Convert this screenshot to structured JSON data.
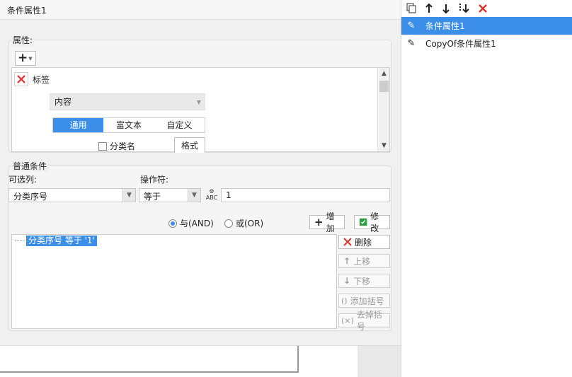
{
  "dialog": {
    "title": "条件属性1"
  },
  "properties": {
    "group_label": "属性:",
    "add_button": "+",
    "item_label": "标签",
    "content_select": "内容",
    "tabs": [
      {
        "label": "通用",
        "active": true
      },
      {
        "label": "富文本",
        "active": false
      },
      {
        "label": "自定义",
        "active": false
      }
    ],
    "category_checkbox": "分类名",
    "format_button": "格式"
  },
  "condition": {
    "group_label": "普通条件",
    "column_label": "可选列:",
    "column_value": "分类序号",
    "operator_label": "操作符:",
    "operator_value": "等于",
    "value_input": "1",
    "radio_and": "与(AND)",
    "radio_or": "或(OR)",
    "add_button": "增加",
    "modify_button": "修改",
    "list_items": [
      "分类序号 等于 '1'"
    ],
    "side_buttons": [
      {
        "label": "删除",
        "icon": "x-icon",
        "enabled": true
      },
      {
        "label": "上移",
        "icon": "arrow-up-icon",
        "enabled": false
      },
      {
        "label": "下移",
        "icon": "arrow-down-icon",
        "enabled": false
      },
      {
        "label": "添加括号",
        "icon": "parentheses-icon",
        "enabled": false
      },
      {
        "label": "去掉括号",
        "icon": "remove-parentheses-icon",
        "enabled": false
      }
    ]
  },
  "right_panel": {
    "toolbar_icons": [
      "copy-icon",
      "arrow-up-icon",
      "arrow-down-icon",
      "move-bottom-icon",
      "delete-icon"
    ],
    "items": [
      {
        "label": "条件属性1",
        "selected": true
      },
      {
        "label": "CopyOf条件属性1",
        "selected": false
      }
    ]
  },
  "colors": {
    "accent": "#3b8fe8",
    "danger": "#e0322e",
    "green": "#2e9e3e"
  }
}
